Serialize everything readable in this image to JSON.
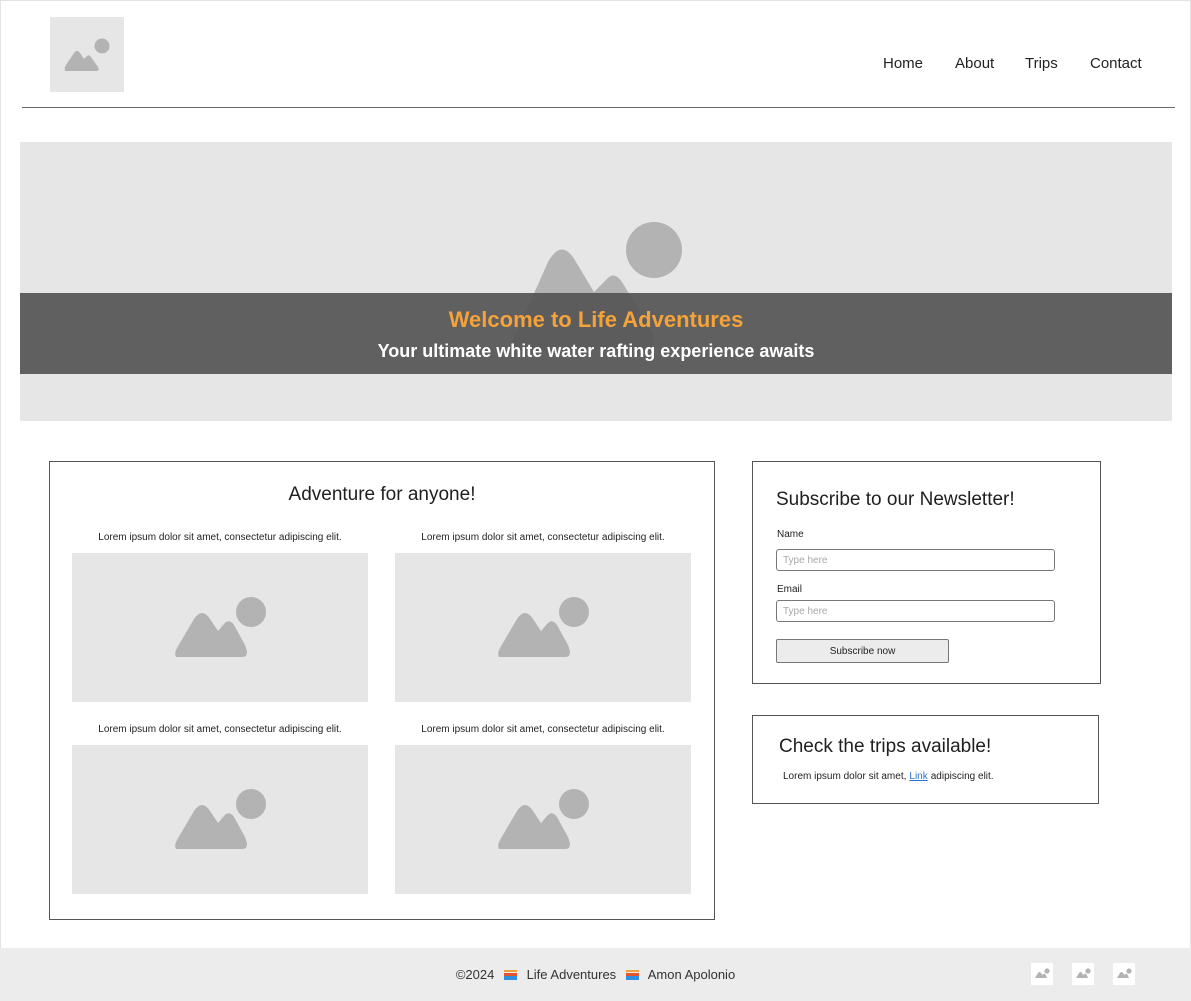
{
  "header": {
    "logo_icon": "image-placeholder-icon",
    "nav": [
      {
        "label": "Home"
      },
      {
        "label": "About"
      },
      {
        "label": "Trips"
      },
      {
        "label": "Contact"
      }
    ]
  },
  "hero": {
    "image_icon": "image-placeholder-icon",
    "title": "Welcome to Life Adventures",
    "subtitle": "Your ultimate white water rafting experience awaits",
    "title_color": "#f5a23a"
  },
  "adventure": {
    "title": "Adventure for anyone!",
    "tiles": [
      {
        "caption": "Lorem ipsum dolor sit amet, consectetur adipiscing elit."
      },
      {
        "caption": "Lorem ipsum dolor sit amet, consectetur adipiscing elit."
      },
      {
        "caption": "Lorem ipsum dolor sit amet, consectetur adipiscing elit."
      },
      {
        "caption": "Lorem ipsum dolor sit amet, consectetur adipiscing elit."
      }
    ]
  },
  "newsletter": {
    "title": "Subscribe to our Newsletter!",
    "name_label": "Name",
    "name_placeholder": "Type here",
    "email_label": "Email",
    "email_placeholder": "Type here",
    "button_label": "Subscribe now"
  },
  "trips": {
    "title": "Check the trips available!",
    "text_before": "Lorem ipsum dolor sit amet,",
    "link_label": "Link",
    "text_after": "adipiscing elit."
  },
  "footer": {
    "copyright": "©2024",
    "company": "Life Adventures",
    "author": "Amon Apolonio",
    "social_icons": [
      "image-placeholder-icon",
      "image-placeholder-icon",
      "image-placeholder-icon"
    ]
  }
}
